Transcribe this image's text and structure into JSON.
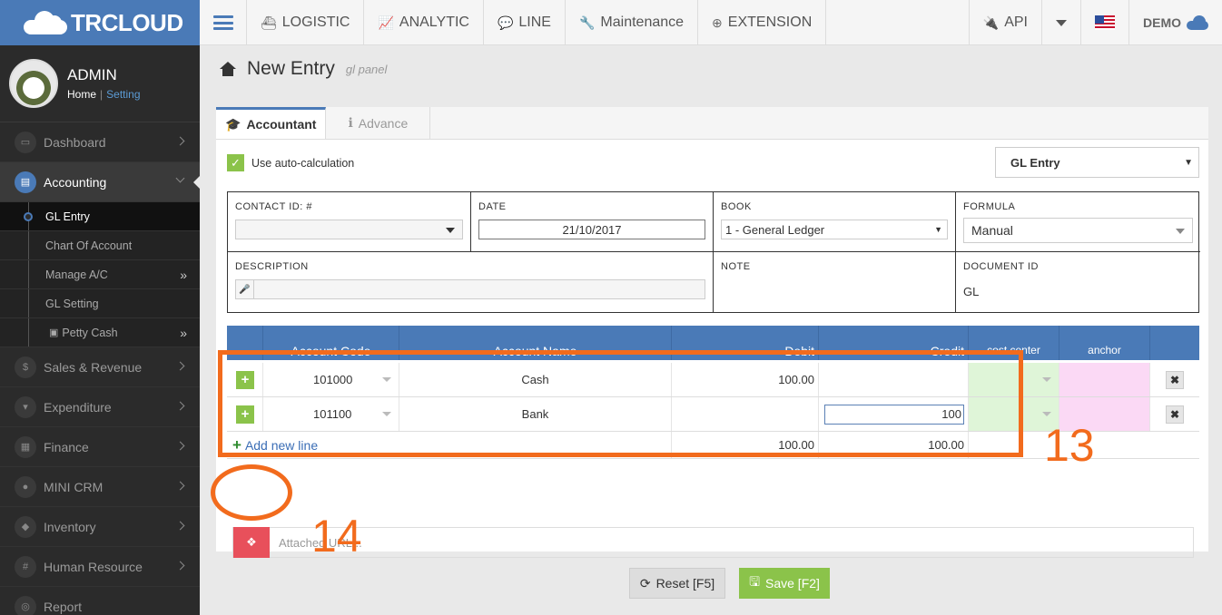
{
  "brand": {
    "name": "TRCLOUD"
  },
  "topnav": {
    "items": [
      {
        "label": "LOGISTIC",
        "icon": "ship-icon"
      },
      {
        "label": "ANALYTIC",
        "icon": "line-chart-icon"
      },
      {
        "label": "LINE",
        "icon": "comments-icon"
      },
      {
        "label": "Maintenance",
        "icon": "wrench-icon"
      },
      {
        "label": "EXTENSION",
        "icon": "plus-circle-icon"
      }
    ],
    "api_label": "API",
    "user_label": "DEMO"
  },
  "profile": {
    "name": "ADMIN",
    "home_link": "Home",
    "separator": "|",
    "setting_link": "Setting"
  },
  "sidebar": {
    "items": [
      {
        "label": "Dashboard"
      },
      {
        "label": "Accounting"
      },
      {
        "label": "Sales & Revenue"
      },
      {
        "label": "Expenditure"
      },
      {
        "label": "Finance"
      },
      {
        "label": "MINI CRM"
      },
      {
        "label": "Inventory"
      },
      {
        "label": "Human Resource"
      },
      {
        "label": "Report"
      }
    ],
    "accounting_sub": [
      {
        "label": "GL Entry"
      },
      {
        "label": "Chart Of Account"
      },
      {
        "label": "Manage A/C"
      },
      {
        "label": "GL Setting"
      },
      {
        "label": "Petty Cash"
      }
    ]
  },
  "page": {
    "title": "New Entry",
    "subtitle": "gl panel"
  },
  "tabs": [
    {
      "label": "Accountant"
    },
    {
      "label": "Advance"
    }
  ],
  "form": {
    "auto_calc_label": "Use auto-calculation",
    "entry_type": "GL Entry",
    "contact_label": "CONTACT ID: #",
    "contact_value": "",
    "date_label": "DATE",
    "date_value": "21/10/2017",
    "book_label": "BOOK",
    "book_value": "1 - General Ledger",
    "formula_label": "FORMULA",
    "formula_value": "Manual",
    "description_label": "DESCRIPTION",
    "description_value": "",
    "note_label": "NOTE",
    "docid_label": "DOCUMENT ID",
    "docid_value": "GL"
  },
  "table": {
    "headers": [
      "Account Code",
      "Account Name",
      "Debit",
      "Credit",
      "cost center",
      "anchor"
    ],
    "rows": [
      {
        "code": "101000",
        "name": "Cash",
        "debit": "100.00",
        "credit": ""
      },
      {
        "code": "101100",
        "name": "Bank",
        "debit": "",
        "credit": "100"
      }
    ],
    "add_line_label": "Add new line",
    "total_debit": "100.00",
    "total_credit": "100.00"
  },
  "attachment": {
    "placeholder": "Attached URL..."
  },
  "buttons": {
    "reset": "Reset [F5]",
    "save": "Save [F2]"
  },
  "annotations": {
    "rect_label": "13",
    "oval_label": "14",
    "color": "#f26b1d"
  }
}
